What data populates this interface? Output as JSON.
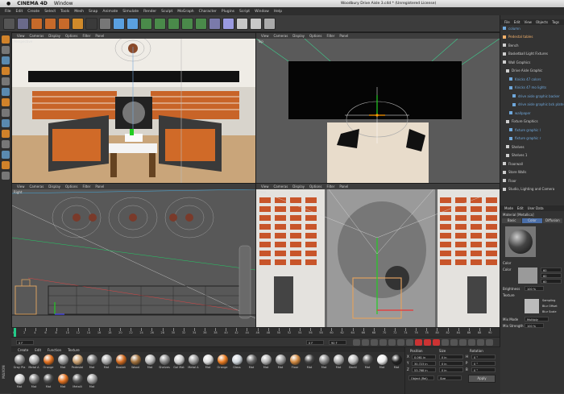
{
  "mac_menu": {
    "app": "CINEMA 4D",
    "items": [
      "Window"
    ]
  },
  "window_title": "Woodbury Drive Aisle 3.c4d * (Unregistered License)",
  "menubar": [
    "File",
    "Edit",
    "Create",
    "Select",
    "Tools",
    "Mesh",
    "Snap",
    "Animate",
    "Simulate",
    "Render",
    "Sculpt",
    "MoGraph",
    "Character",
    "Plugins",
    "Script",
    "Window",
    "Help"
  ],
  "viewport_menu": [
    "View",
    "Cameras",
    "Display",
    "Options",
    "Filter",
    "Panel"
  ],
  "viewports": {
    "perspective": {
      "label": "Perspective"
    },
    "top": {
      "label": "Top"
    },
    "right": {
      "label": "Right"
    },
    "front": {
      "label": "Front"
    }
  },
  "object_manager": {
    "tabs": [
      "File",
      "Edit",
      "View",
      "Objects",
      "Tags"
    ],
    "items": [
      {
        "label": "column",
        "color": "#6fa8dc"
      },
      {
        "label": "Pedestal tables",
        "color": "#f6b26b"
      },
      {
        "label": "Bench",
        "color": "#cfcfcf"
      },
      {
        "label": "Basketball Light Fixtures",
        "color": "#cfcfcf"
      },
      {
        "label": "Wall Graphics",
        "color": "#cfcfcf"
      },
      {
        "label": "Drive Aisle Graphic",
        "color": "#cfcfcf"
      },
      {
        "label": "Knicks 47 colors",
        "color": "#6fa8dc"
      },
      {
        "label": "Knicks 47 mo lights",
        "color": "#6fa8dc"
      },
      {
        "label": "drive aisle graphic backer",
        "color": "#6fa8dc"
      },
      {
        "label": "drive aisle graphic bck plate",
        "color": "#6fa8dc"
      },
      {
        "label": "wallpaper",
        "color": "#6fa8dc"
      },
      {
        "label": "Fixture Graphics",
        "color": "#cfcfcf"
      },
      {
        "label": "fixture graphic l",
        "color": "#6fa8dc"
      },
      {
        "label": "fixture graphic r",
        "color": "#6fa8dc"
      },
      {
        "label": "Shelves",
        "color": "#cfcfcf"
      },
      {
        "label": "Shelves 1",
        "color": "#cfcfcf"
      },
      {
        "label": "Floorwall",
        "color": "#cfcfcf"
      },
      {
        "label": "Store Walls",
        "color": "#cfcfcf"
      },
      {
        "label": "Floor",
        "color": "#cfcfcf"
      },
      {
        "label": "Studio, Lighting and Camera",
        "color": "#cfcfcf"
      }
    ]
  },
  "attributes": {
    "tabs": [
      "Mode",
      "Edit",
      "User Data"
    ],
    "material_name": "Material [Metallica]",
    "subtabs": [
      "Basic",
      "Color",
      "Diffusion"
    ],
    "section": "Color",
    "color_label": "Color",
    "rgb": [
      "60",
      "60",
      "60"
    ],
    "brightness_label": "Brightness",
    "brightness_value": "100 %",
    "texture_label": "Texture",
    "sampling_label": "Sampling",
    "blur_offset_label": "Blur Offset",
    "blur_scale_label": "Blur Scale",
    "mix_mode_label": "Mix Mode",
    "mix_mode_value": "Multiply",
    "mix_strength_label": "Mix Strength",
    "mix_strength_value": "100 %"
  },
  "timeline": {
    "ticks": [
      "0",
      "2",
      "4",
      "6",
      "8",
      "10",
      "12",
      "14",
      "16",
      "18",
      "20",
      "22",
      "24",
      "26",
      "28",
      "30",
      "32",
      "34",
      "36",
      "38",
      "40",
      "42",
      "44",
      "46",
      "48",
      "50",
      "52",
      "54",
      "56",
      "58",
      "60",
      "62",
      "64",
      "66",
      "68",
      "70",
      "72",
      "74",
      "76",
      "78",
      "80",
      "82",
      "84",
      "86",
      "88",
      "90"
    ],
    "current_frame": "0 F",
    "start_field": "0 F",
    "end_field": "90 F"
  },
  "material_manager": {
    "menu": [
      "Create",
      "Edit",
      "Function",
      "Texture"
    ],
    "materials": [
      {
        "label": "Gray Pla",
        "color": "#8c8c8c"
      },
      {
        "label": "Metal A",
        "color": "#b0b0b0"
      },
      {
        "label": "Orange",
        "color": "#e07020"
      },
      {
        "label": "Mat",
        "color": "#999"
      },
      {
        "label": "Pedestal",
        "color": "#c9a070"
      },
      {
        "label": "Mat",
        "color": "#777"
      },
      {
        "label": "Mat",
        "color": "#aaa"
      },
      {
        "label": "Basket",
        "color": "#d06a20"
      },
      {
        "label": "Wood",
        "color": "#a0703c"
      },
      {
        "label": "Mat",
        "color": "#bbb"
      },
      {
        "label": "Shelves",
        "color": "#888"
      },
      {
        "label": "Gal Mat",
        "color": "#ccc"
      },
      {
        "label": "Metal A",
        "color": "#999"
      },
      {
        "label": "Mat",
        "color": "#ddd"
      },
      {
        "label": "Orange",
        "color": "#e87a20"
      },
      {
        "label": "Glass",
        "color": "#cfd6dc"
      },
      {
        "label": "Mat",
        "color": "#666"
      },
      {
        "label": "Mat",
        "color": "#b5b5b5"
      },
      {
        "label": "Mat",
        "color": "#999"
      },
      {
        "label": "Floor",
        "color": "#d08840"
      },
      {
        "label": "Mat",
        "color": "#444"
      },
      {
        "label": "Mat",
        "color": "#888"
      },
      {
        "label": "Mat",
        "color": "#aaa"
      },
      {
        "label": "Backl",
        "color": "#bbb"
      },
      {
        "label": "Mat",
        "color": "#555"
      },
      {
        "label": "Mat",
        "color": "#eee"
      },
      {
        "label": "Mat",
        "color": "#222"
      },
      {
        "label": "Mat",
        "color": "#cfcfcf"
      },
      {
        "label": "Mat",
        "color": "#7a7a7a"
      },
      {
        "label": "Mat",
        "color": "#4a4a4a"
      },
      {
        "label": "Mat",
        "color": "#e07020"
      },
      {
        "label": "Metalli",
        "color": "#555"
      },
      {
        "label": "Mat",
        "color": "#9a9a9a"
      }
    ]
  },
  "coordinates": {
    "headers": [
      "Position",
      "Size",
      "Rotation"
    ],
    "rows": [
      {
        "axis": "X",
        "pos": "0.061 in",
        "size": "0 in",
        "rot_axis": "H",
        "rot": "0 °"
      },
      {
        "axis": "Y",
        "pos": "30.723 in",
        "size": "0 in",
        "rot_axis": "P",
        "rot": "0 °"
      },
      {
        "axis": "Z",
        "pos": "53.768 in",
        "size": "0 in",
        "rot_axis": "B",
        "rot": "0 °"
      }
    ],
    "mode_select": "Object (Rel)",
    "size_select": "Size",
    "apply_label": "Apply"
  },
  "brand": "MAXON"
}
